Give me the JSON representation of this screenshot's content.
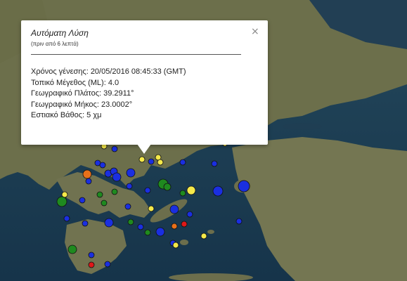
{
  "popup": {
    "title": "Αυτόματη Λύση",
    "subtitle": "(πριν από 6 λεπτά)",
    "close_symbol": "×",
    "lines": [
      "Χρόνος γένεσης: 20/05/2016  08:45:33 (GMT)",
      "Τοπικό Μέγεθος (ML): 4.0",
      "Γεωγραφικό Πλάτος: 39.2911°",
      "Γεωγραφικό Μήκος: 23.0002°",
      "Εστιακό Βάθος: 5 χμ"
    ]
  },
  "marker_colors": {
    "yellow": "#f5e94a",
    "blue": "#1a2fe0",
    "green": "#1f8a1f",
    "orange": "#e8701a",
    "red": "#e01818"
  },
  "map_colors": {
    "sea": "#1d3f55",
    "land": "#6a6e4a",
    "land_light": "#8a8a66",
    "mountain": "#7d7560"
  }
}
